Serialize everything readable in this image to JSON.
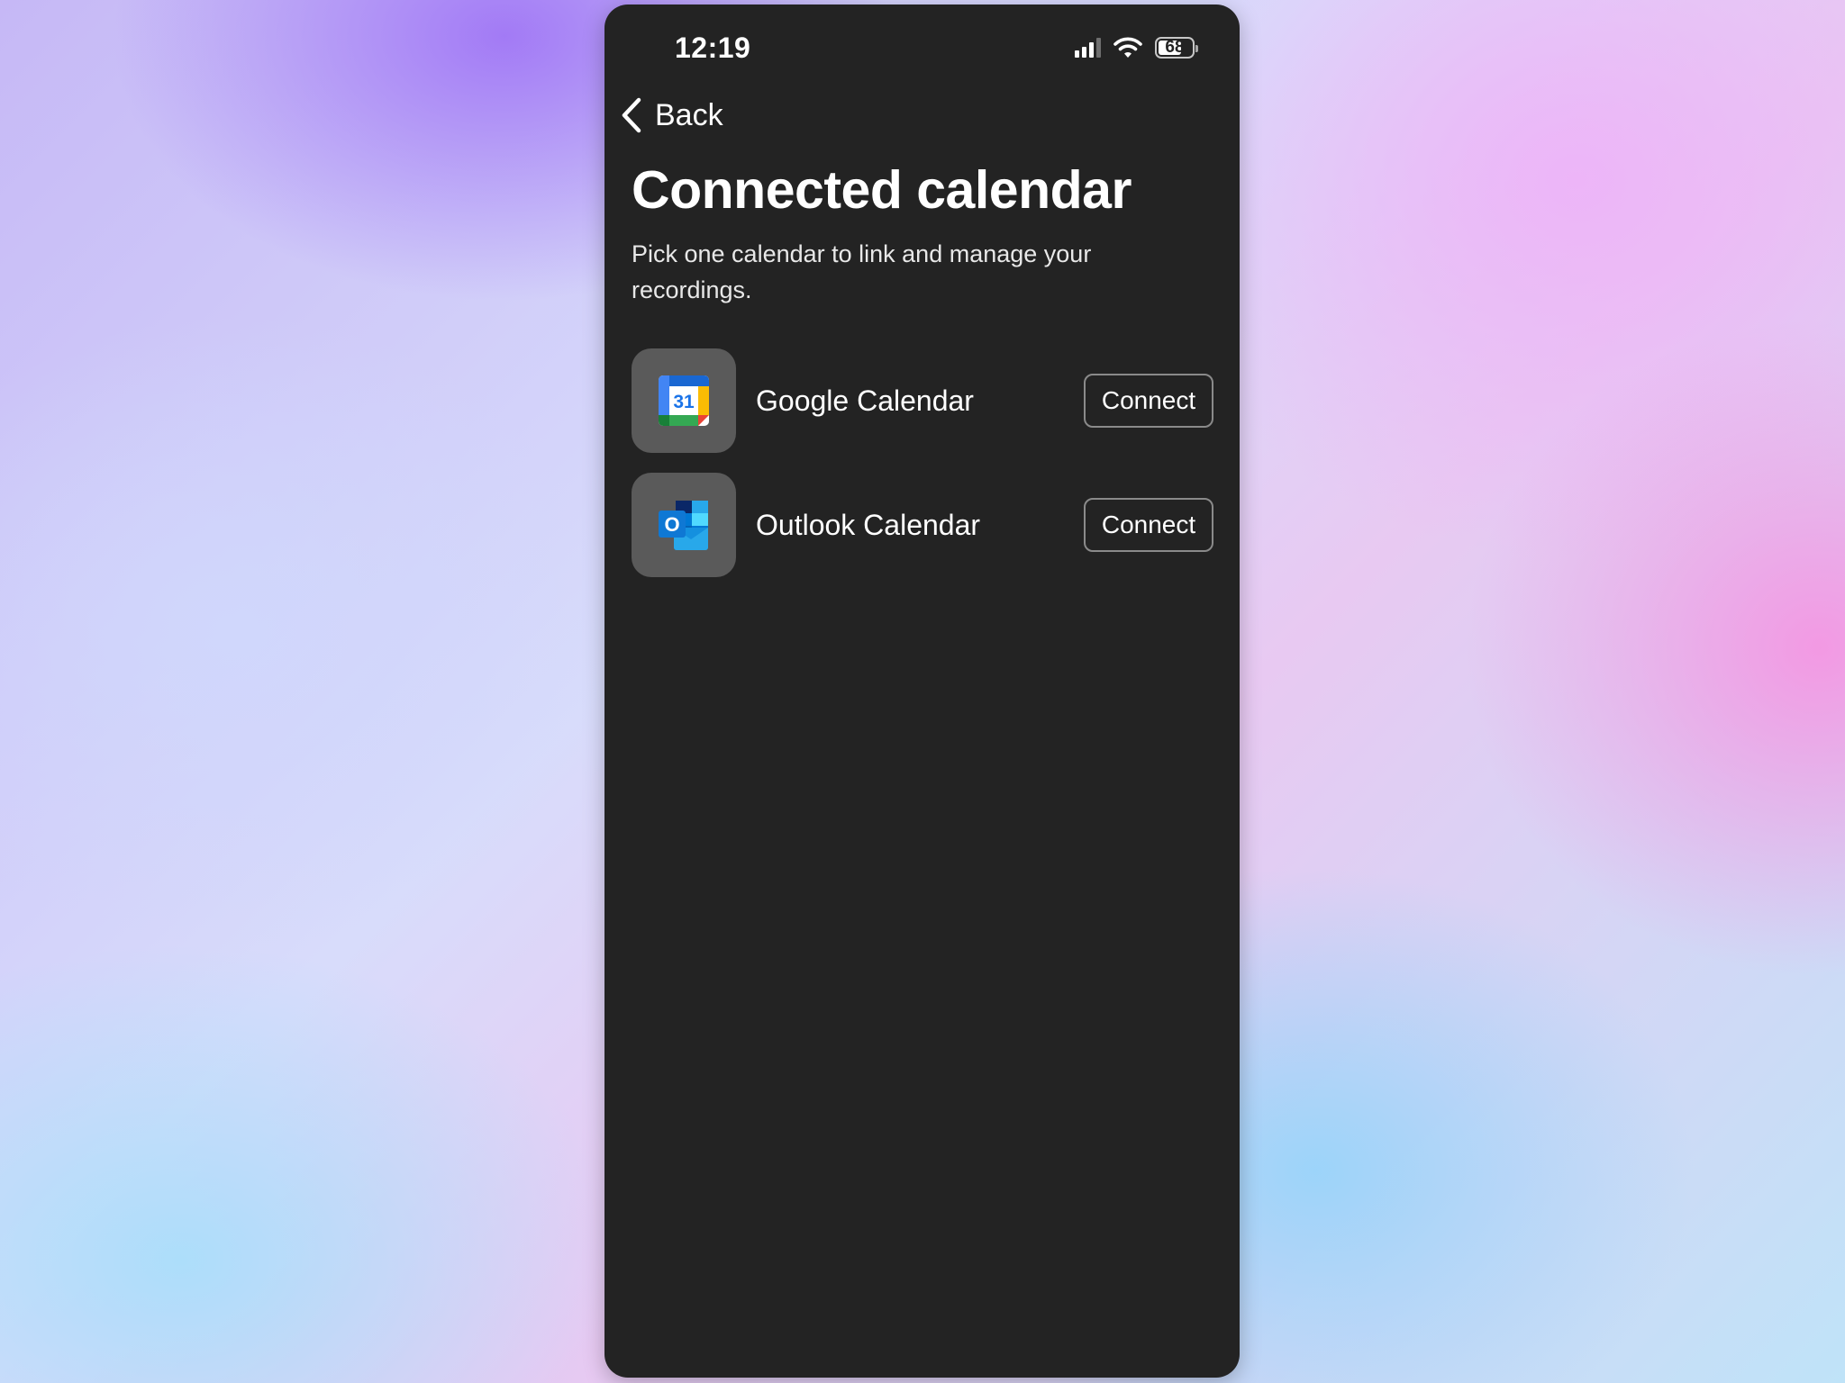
{
  "status_bar": {
    "time": "12:19",
    "battery_percent": "68",
    "signal_bars_active": 3,
    "signal_bars_total": 4
  },
  "nav": {
    "back_label": "Back"
  },
  "page": {
    "title": "Connected calendar",
    "subtitle": "Pick one calendar to link and manage your recordings."
  },
  "calendars": [
    {
      "name": "Google Calendar",
      "icon": "google-calendar-icon",
      "icon_text": "31",
      "button_label": "Connect"
    },
    {
      "name": "Outlook Calendar",
      "icon": "outlook-calendar-icon",
      "icon_text": "O",
      "button_label": "Connect"
    }
  ],
  "colors": {
    "screen_background": "#232323",
    "icon_tile": "#5a5a5a",
    "button_border": "#8a8a8a",
    "text": "#ffffff"
  }
}
